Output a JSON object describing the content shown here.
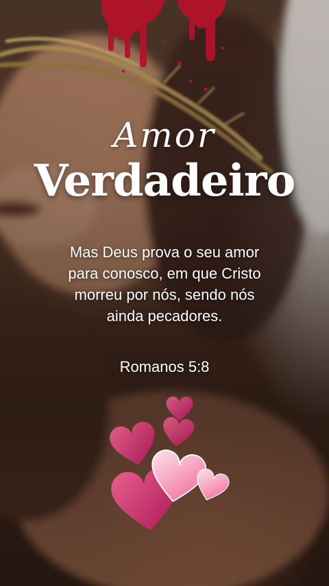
{
  "title": {
    "script": "Amor",
    "main": "Verdadeiro"
  },
  "verse": {
    "lines": [
      "Mas Deus prova o seu amor",
      "para conosco, em que Cristo",
      "morreu por nós, sendo nós",
      "ainda pecadores."
    ],
    "reference": "Romanos 5:8"
  },
  "colors": {
    "text": "#ffffff",
    "blood": "#b3122a",
    "heart_dark": "#d81b60",
    "heart_light": "#f48fb1"
  }
}
